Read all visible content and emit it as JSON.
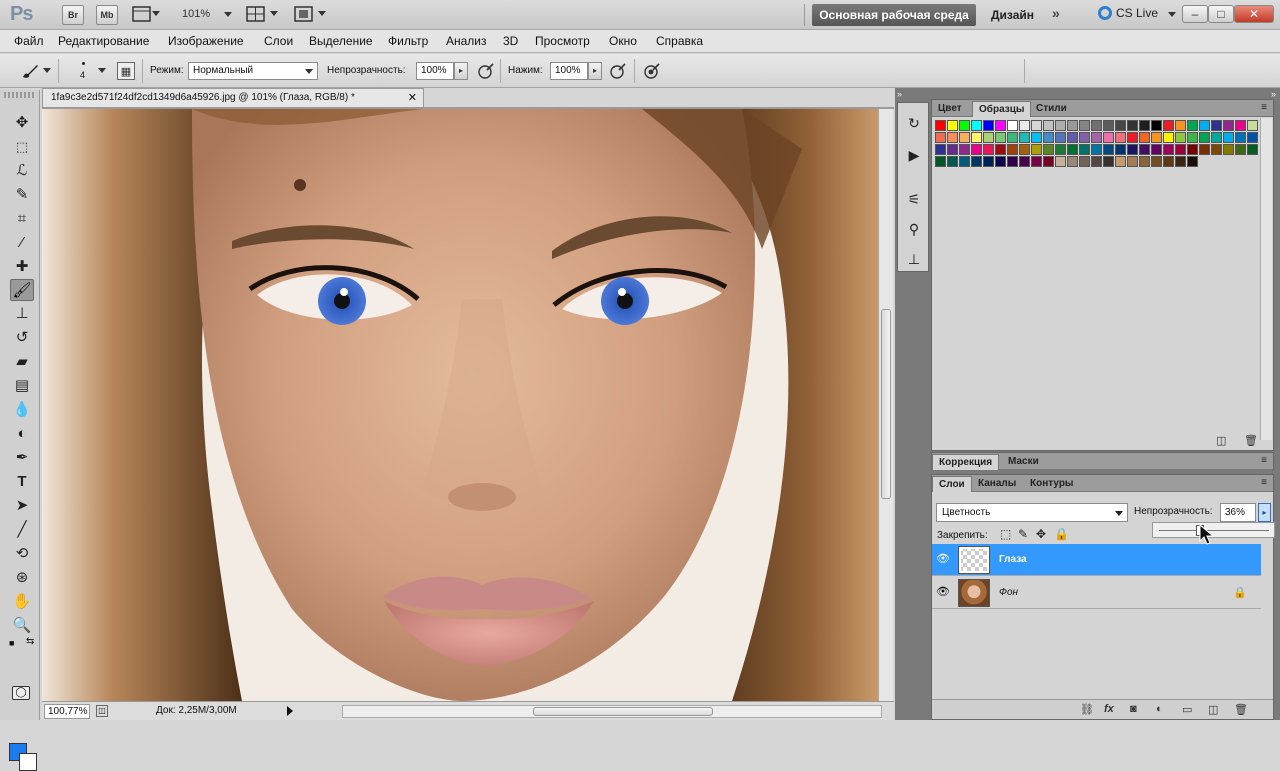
{
  "app": {
    "logo": "Ps",
    "bridge_label": "Br",
    "minibridge_label": "Mb",
    "zoom_level": "101%",
    "workspace_label": "Основная рабочая среда",
    "design_label": "Дизайн",
    "more_label": "»",
    "cslive_label": "CS Live"
  },
  "menu": [
    "Файл",
    "Редактирование",
    "Изображение",
    "Слои",
    "Выделение",
    "Фильтр",
    "Анализ",
    "3D",
    "Просмотр",
    "Окно",
    "Справка"
  ],
  "options": {
    "brush_size": "4",
    "mode_label": "Режим:",
    "mode_value": "Нормальный",
    "opacity_label": "Непрозрачность:",
    "opacity_value": "100%",
    "flow_label": "Нажим:",
    "flow_value": "100%"
  },
  "document": {
    "tab_title": "1fa9c3e2d571f24df2cd1349d6a45926.jpg @ 101% (Глаза, RGB/8) *",
    "zoom_status": "100,77%",
    "doc_info": "Док: 2,25M/3,00M"
  },
  "swatches_panel": {
    "tabs": [
      "Цвет",
      "Образцы",
      "Стили"
    ],
    "active_tab": "Образцы",
    "colors": [
      "#ff0000",
      "#ffff00",
      "#00ff00",
      "#00ffff",
      "#0000ff",
      "#ff00ff",
      "#ffffff",
      "#ebebeb",
      "#d6d6d6",
      "#c2c2c2",
      "#adadad",
      "#999999",
      "#858585",
      "#707070",
      "#5c5c5c",
      "#474747",
      "#333333",
      "#1f1f1f",
      "#000000",
      "#ed1c24",
      "#f7941d",
      "#00a651",
      "#00aeef",
      "#2e3192",
      "#92278f",
      "#ec008c",
      "#c4df9b",
      "#f26c4f",
      "#f68e56",
      "#fbaf5d",
      "#fff568",
      "#acd373",
      "#7cc576",
      "#3bb878",
      "#1abbb4",
      "#00bff3",
      "#438ccb",
      "#5574b9",
      "#605ca8",
      "#855fa8",
      "#a763a8",
      "#f06eaa",
      "#f26d7d",
      "#ed1c24",
      "#f26522",
      "#f7941d",
      "#fff200",
      "#8dc63f",
      "#39b54a",
      "#00a651",
      "#00a99d",
      "#00aeef",
      "#0072bc",
      "#0054a6",
      "#2e3192",
      "#662d91",
      "#92278f",
      "#ec008c",
      "#ed145b",
      "#9e0b0f",
      "#a0410d",
      "#a3620a",
      "#aba000",
      "#598527",
      "#1a7b30",
      "#007236",
      "#00746b",
      "#0076a3",
      "#004a80",
      "#003471",
      "#1b1464",
      "#440e62",
      "#630460",
      "#9e005d",
      "#9e0039",
      "#790000",
      "#7b2e00",
      "#7d4900",
      "#827b00",
      "#406618",
      "#005e20",
      "#005826",
      "#005952",
      "#005b7f",
      "#003663",
      "#002157",
      "#0d004c",
      "#32004b",
      "#4b0049",
      "#7b0046",
      "#7a0026",
      "#c7b299",
      "#998675",
      "#736357",
      "#534741",
      "#37302d",
      "#c69c6d",
      "#a67c52",
      "#8c6239",
      "#754c24",
      "#603913",
      "#3c2415",
      "#1a0f06"
    ]
  },
  "adjust_panel": {
    "tabs": [
      "Коррекция",
      "Маски"
    ]
  },
  "layers_panel": {
    "tabs": [
      "Слои",
      "Каналы",
      "Контуры"
    ],
    "blend_mode": "Цветность",
    "opacity_label": "Непрозрачность:",
    "opacity_value": "36%",
    "opacity_level": 0.36,
    "lock_label": "Закрепить:",
    "layers": [
      {
        "name": "Глаза",
        "selected": true,
        "visible": true
      },
      {
        "name": "Фон",
        "selected": false,
        "visible": true,
        "locked": true
      }
    ]
  }
}
